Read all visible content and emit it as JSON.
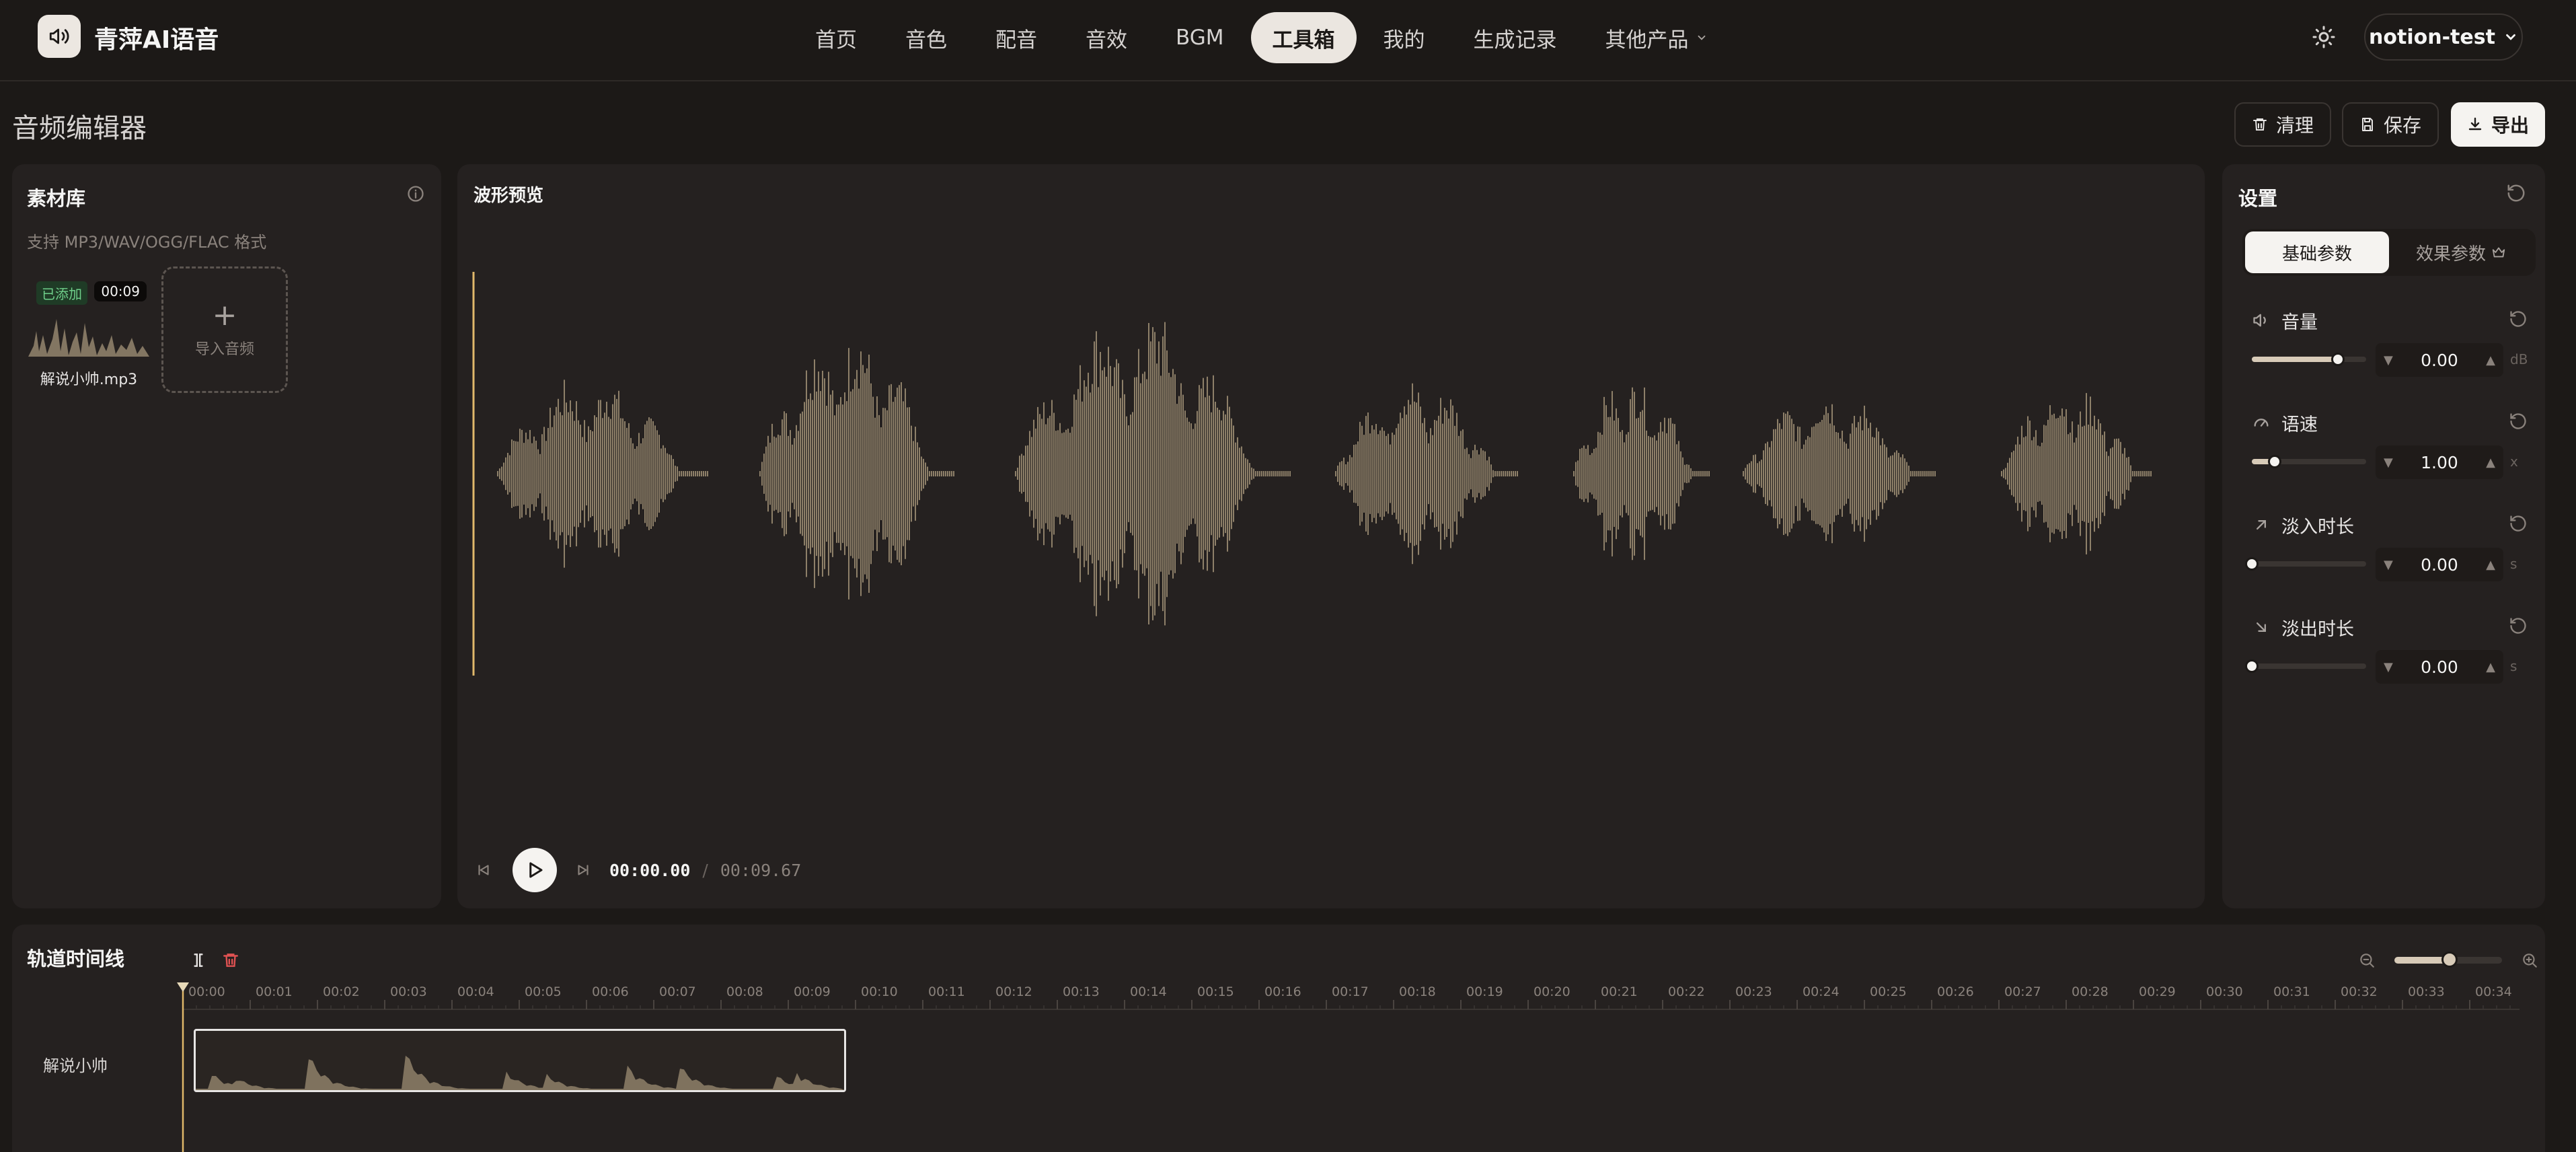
{
  "app": {
    "brand": "青萍AI语音",
    "user": "notion-test"
  },
  "nav": {
    "items": [
      "首页",
      "音色",
      "配音",
      "音效",
      "BGM",
      "工具箱",
      "我的",
      "生成记录",
      "其他产品"
    ],
    "active": "工具箱"
  },
  "page": {
    "title": "音频编辑器",
    "buttons": {
      "clear": "清理",
      "save": "保存",
      "export": "导出"
    }
  },
  "library": {
    "title": "素材库",
    "subtitle": "支持 MP3/WAV/OGG/FLAC 格式",
    "item": {
      "badge": "已添加",
      "duration": "00:09",
      "name": "解说小帅.mp3"
    },
    "import_label": "导入音频"
  },
  "waveform": {
    "title": "波形预览",
    "current_time": "00:00.00",
    "separator": "/",
    "total_time": "00:09.67"
  },
  "settings": {
    "title": "设置",
    "tabs": {
      "basic": "基础参数",
      "effect": "效果参数"
    },
    "params": [
      {
        "name": "音量",
        "value": "0.00",
        "unit": "dB",
        "level": 0.75
      },
      {
        "name": "语速",
        "value": "1.00",
        "unit": "x",
        "level": 0.2
      },
      {
        "name": "淡入时长",
        "value": "0.00",
        "unit": "s",
        "level": 0.0
      },
      {
        "name": "淡出时长",
        "value": "0.00",
        "unit": "s",
        "level": 0.0
      }
    ]
  },
  "timeline": {
    "title": "轨道时间线",
    "track_name": "解说小帅",
    "ticks": [
      "00:00",
      "00:01",
      "00:02",
      "00:03",
      "00:04",
      "00:05",
      "00:06",
      "00:07",
      "00:08",
      "00:09",
      "00:10",
      "00:11",
      "00:12",
      "00:13",
      "00:14",
      "00:15",
      "00:16",
      "00:17",
      "00:18",
      "00:19",
      "00:20",
      "00:21",
      "00:22",
      "00:23",
      "00:24",
      "00:25",
      "00:26",
      "00:27",
      "00:28",
      "00:29",
      "00:30",
      "00:31",
      "00:32",
      "00:33",
      "00:34"
    ],
    "zoom_level": 0.5
  },
  "colors": {
    "background": "#1c1917",
    "panel": "#252120",
    "waveform": "#8e8069",
    "playhead": "#e0b86a",
    "accent": "#f5f3f0",
    "danger": "#e05252",
    "added_badge": "#6fcf8a"
  }
}
